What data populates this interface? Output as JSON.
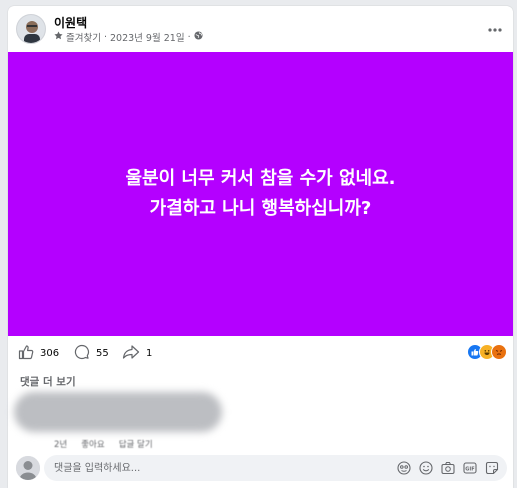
{
  "post": {
    "author": "이원택",
    "favorites_label": "즐겨찾기",
    "separator": "·",
    "date": "2023년 9월 21일",
    "background_color": "#b400ff",
    "text_lines": [
      "울분이 너무 커서 참을 수가 없네요.",
      "가결하고 나니 행복하십니까?"
    ]
  },
  "stats": {
    "likes": "306",
    "comments": "55",
    "shares": "1"
  },
  "comments": {
    "more_label": "댓글 더 보기",
    "actions": [
      "2년",
      "좋아요",
      "답글 달기"
    ],
    "input_placeholder": "댓글을 입력하세요..."
  },
  "colors": {
    "like_blue": "#1877f2",
    "haha_yellow": "#f7b125",
    "angry_orange": "#e9710f"
  }
}
